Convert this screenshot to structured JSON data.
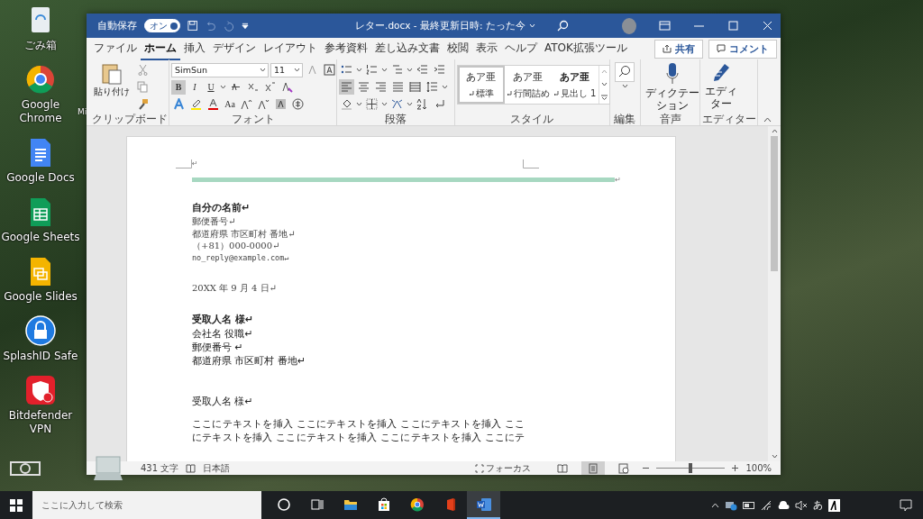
{
  "desktop": {
    "icons": [
      {
        "label": "ごみ箱",
        "kind": "recycle"
      },
      {
        "label": "Google Chrome",
        "kind": "chrome"
      },
      {
        "label": "Google Docs",
        "kind": "docs"
      },
      {
        "label": "Google Sheets",
        "kind": "sheets"
      },
      {
        "label": "Google Slides",
        "kind": "slides"
      },
      {
        "label": "SplashID Safe",
        "kind": "lock"
      },
      {
        "label": "Bitdefender VPN",
        "kind": "vpn"
      }
    ],
    "partial_label": "Mi"
  },
  "window": {
    "autosave": {
      "label": "自動保存",
      "toggle": "オン",
      "on": true
    },
    "title": "レター.docx - 最終更新日時: たった今"
  },
  "tabs": [
    {
      "label": "ファイル",
      "selected": false
    },
    {
      "label": "ホーム",
      "selected": true
    },
    {
      "label": "挿入",
      "selected": false
    },
    {
      "label": "デザイン",
      "selected": false
    },
    {
      "label": "レイアウト",
      "selected": false
    },
    {
      "label": "参考資料",
      "selected": false
    },
    {
      "label": "差し込み文書",
      "selected": false
    },
    {
      "label": "校閲",
      "selected": false
    },
    {
      "label": "表示",
      "selected": false
    },
    {
      "label": "ヘルプ",
      "selected": false
    },
    {
      "label": "ATOK拡張ツール",
      "selected": false
    }
  ],
  "share_button": "共有",
  "comment_button": "コメント",
  "ribbon": {
    "clipboard": {
      "paste": "貼り付け",
      "label": "クリップボード"
    },
    "font": {
      "name": "SimSun",
      "size": "11",
      "format_buttons": [
        {
          "label": "B",
          "pressed": true
        },
        {
          "label": "I",
          "pressed": false
        },
        {
          "label": "U",
          "pressed": false
        }
      ],
      "case_button": "Aa",
      "label": "フォント"
    },
    "paragraph": {
      "alignments": [
        {
          "selected": true
        },
        {
          "selected": false
        },
        {
          "selected": false
        },
        {
          "selected": false
        },
        {
          "selected": false
        }
      ],
      "label": "段落"
    },
    "styles": {
      "items": [
        {
          "sample": "あア亜",
          "name": "標準",
          "selected": true
        },
        {
          "sample": "あア亜",
          "name": "行間詰め",
          "selected": false
        },
        {
          "sample": "あア亜",
          "name": "見出し 1",
          "selected": false
        }
      ],
      "label": "スタイル"
    },
    "editing": {
      "label": "編集"
    },
    "voice": {
      "button": "ディクテーション",
      "label": "音声"
    },
    "editor": {
      "button": "エディター",
      "label": "エディター"
    }
  },
  "document": {
    "header_mark": "↵",
    "rule_mark": "↵",
    "blocks": [
      {
        "lines": [
          {
            "text": "自分の名前↵",
            "kind": "heading"
          },
          {
            "text": "郵便番号↵",
            "kind": "small"
          },
          {
            "text": "都道府県 市区町村 番地↵",
            "kind": "small"
          },
          {
            "text": "（+81）000-0000↵",
            "kind": "small"
          },
          {
            "text": "no_reply@example.com↵",
            "kind": "mono"
          }
        ]
      },
      {
        "lines": [
          {
            "text": "20XX 年 9 月 4 日↵",
            "kind": "small"
          }
        ]
      },
      {
        "lines": [
          {
            "text": "受取人名 様↵",
            "kind": "heading"
          },
          {
            "text": "会社名 役職↵",
            "kind": "normal"
          },
          {
            "text": "郵便番号 ↵",
            "kind": "normal"
          },
          {
            "text": "都道府県 市区町村 番地↵",
            "kind": "normal"
          }
        ]
      },
      {
        "lines": [
          {
            "text": "受取人名 様↵",
            "kind": "normal"
          }
        ]
      },
      {
        "lines": [
          {
            "text": "ここにテキストを挿入 ここにテキストを挿入 ここにテキストを挿入 ここにテキストを挿入 ここにテキストを挿入 ここにテキストを挿入 ここにテ",
            "kind": "body"
          }
        ]
      }
    ]
  },
  "status_bar": {
    "word_count": "431 文字",
    "language": "日本語",
    "focus": "フォーカス",
    "views": [
      {
        "kind": "read",
        "selected": false
      },
      {
        "kind": "print",
        "selected": true
      },
      {
        "kind": "web",
        "selected": false
      }
    ],
    "zoom": {
      "level": 0.5,
      "reading": "100%"
    }
  },
  "taskbar": {
    "search": {
      "placeholder": "ここに入力して検索"
    },
    "apps": [
      {
        "kind": "cortana",
        "selected": false
      },
      {
        "kind": "taskview",
        "selected": false
      },
      {
        "kind": "explorer",
        "selected": false
      },
      {
        "kind": "store",
        "selected": false
      },
      {
        "kind": "chrome",
        "selected": false
      },
      {
        "kind": "office",
        "selected": false
      },
      {
        "kind": "word",
        "selected": true
      }
    ],
    "ime": "あ"
  }
}
